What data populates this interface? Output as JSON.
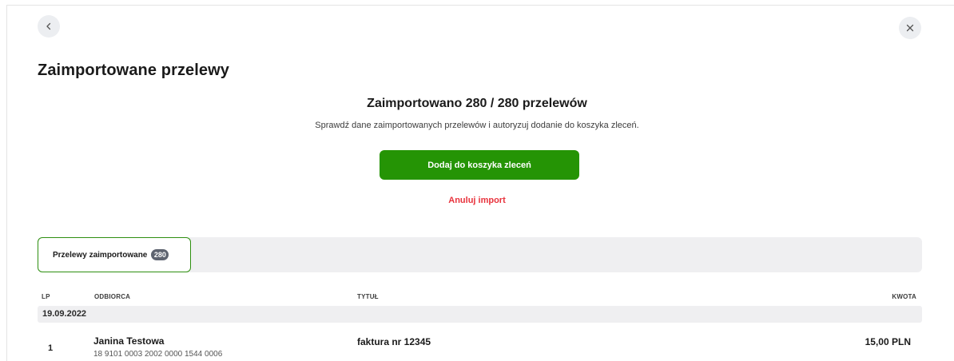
{
  "header": {
    "back_icon": "chevron-left-icon",
    "close_icon": "close-icon",
    "page_title": "Zaimportowane przelewy"
  },
  "summary": {
    "title": "Zaimportowano 280 / 280 przelewów",
    "subtitle": "Sprawdź dane zaimportowanych przelewów i autoryzuj dodanie do koszyka zleceń.",
    "primary_button": "Dodaj do koszyka zleceń",
    "cancel_link": "Anuluj import"
  },
  "tabs": [
    {
      "label": "Przelewy zaimportowane",
      "count": "280",
      "active": true
    }
  ],
  "table": {
    "columns": {
      "lp": "LP",
      "recipient": "ODBIORCA",
      "title": "TYTUŁ",
      "amount": "KWOTA"
    },
    "groups": [
      {
        "date": "19.09.2022",
        "rows": [
          {
            "lp": "1",
            "name": "Janina Testowa",
            "account": "18 9101 0003 2002 0000 1544 0006",
            "title": "faktura nr 12345",
            "amount": "15,00 PLN"
          }
        ]
      }
    ]
  },
  "colors": {
    "primary": "#259405",
    "cancel": "#e8323c",
    "tab_border": "#2e8f10",
    "badge": "#5e6470"
  }
}
